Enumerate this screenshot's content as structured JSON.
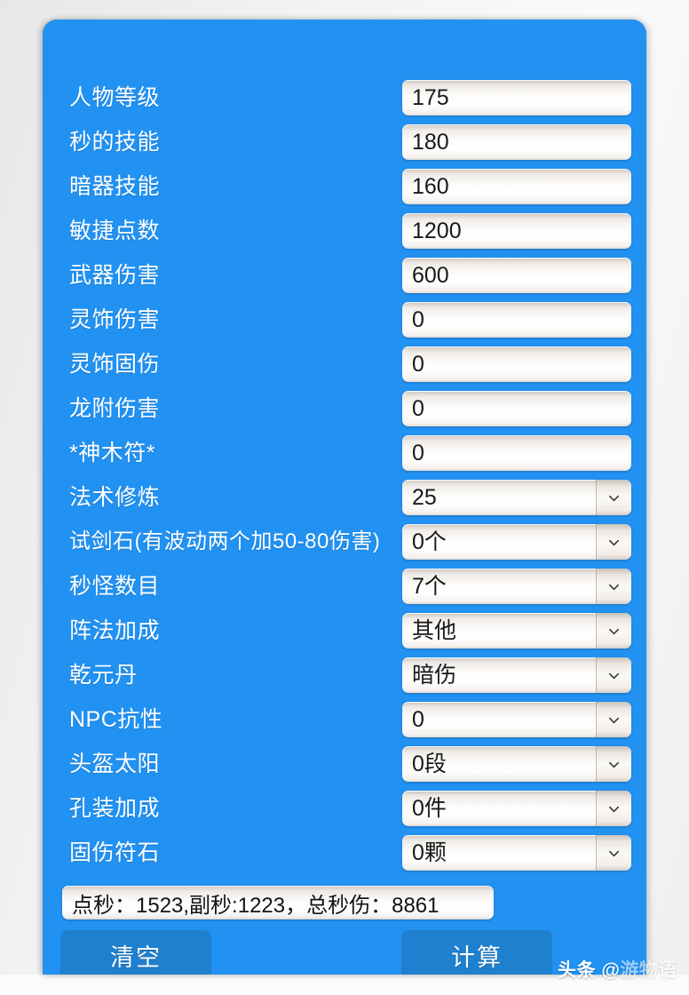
{
  "app": {
    "panel_color": "#2191f2",
    "button_color": "#1f80cf",
    "field_text_color": "#191919",
    "label_color": "#ffffff"
  },
  "form": {
    "rows": [
      {
        "label": "人物等级",
        "control": "input",
        "value": "175"
      },
      {
        "label": "秒的技能",
        "control": "input",
        "value": "180"
      },
      {
        "label": "暗器技能",
        "control": "input",
        "value": "160"
      },
      {
        "label": "敏捷点数",
        "control": "input",
        "value": "1200"
      },
      {
        "label": "武器伤害",
        "control": "input",
        "value": "600"
      },
      {
        "label": "灵饰伤害",
        "control": "input",
        "value": "0"
      },
      {
        "label": "灵饰固伤",
        "control": "input",
        "value": "0"
      },
      {
        "label": "龙附伤害",
        "control": "input",
        "value": "0"
      },
      {
        "label": "*神木符*",
        "control": "input",
        "value": "0"
      },
      {
        "label": "法术修炼",
        "control": "select",
        "value": "25"
      },
      {
        "label": "试剑石(有波动两个加50-80伤害)",
        "control": "select",
        "value": "0个"
      },
      {
        "label": "秒怪数目",
        "control": "select",
        "value": "7个"
      },
      {
        "label": "阵法加成",
        "control": "select",
        "value": "其他"
      },
      {
        "label": "乾元丹",
        "control": "select",
        "value": "暗伤"
      },
      {
        "label": "NPC抗性",
        "control": "select",
        "value": "0"
      },
      {
        "label": "头盔太阳",
        "control": "select",
        "value": "0段"
      },
      {
        "label": "孔装加成",
        "control": "select",
        "value": "0件"
      },
      {
        "label": "固伤符石",
        "control": "select",
        "value": "0颗"
      }
    ]
  },
  "result": {
    "text": "点秒：1523,副秒:1223，总秒伤：8861",
    "dian_miao": 1523,
    "fu_miao": 1223,
    "zong_miao_shang": 8861
  },
  "buttons": {
    "clear_label": "清空",
    "calculate_label": "计算"
  },
  "watermark": {
    "prefix": "头条 @",
    "handle": "游物语"
  },
  "icons": {
    "chevron_down": "chevron-down-icon"
  }
}
